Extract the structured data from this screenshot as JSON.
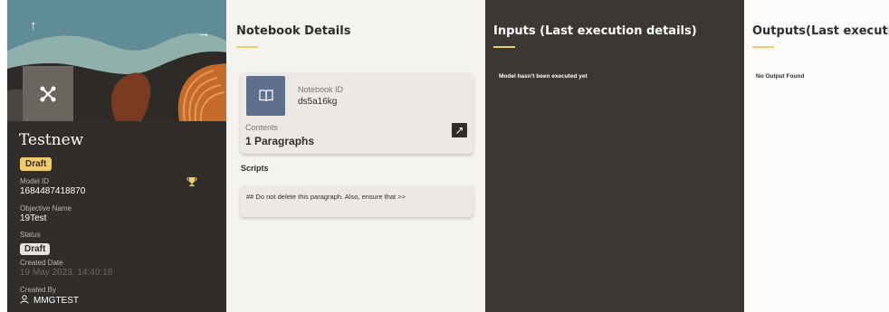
{
  "model": {
    "name": "Testnew",
    "draft_badge": "Draft",
    "model_id_label": "Model ID",
    "model_id": "1684487418870",
    "objective_label": "Objective Name",
    "objective": "19Test",
    "status_label": "Status",
    "status": "Draft",
    "created_date_label": "Created Date",
    "created_date": "19 May 2023, 14:40:18",
    "created_by_label": "Created By",
    "created_by": "MMGTEST"
  },
  "notebook": {
    "title": "Notebook Details",
    "id_label": "Notebook ID",
    "id": "ds5a16kg",
    "contents_label": "Contents",
    "contents_value": "1 Paragraphs",
    "scripts_label": "Scripts",
    "script_text": "## Do not delete this paragraph. Also, ensure that  >>"
  },
  "inputs": {
    "title": "Inputs (Last execution details)",
    "message": "Model hasn't been executed yet"
  },
  "outputs": {
    "title": "Outputs(Last execution",
    "message": "No Output Found"
  },
  "icons": {
    "up": "arrow-up-icon",
    "right": "arrow-right-icon",
    "model": "model-graph-icon",
    "trophy": "trophy-icon",
    "user": "user-icon",
    "notebook": "book-icon",
    "expand": "expand-icon"
  },
  "colors": {
    "dark_panel": "#312d2a",
    "accent": "#f0cc71",
    "notebook_icon_bg": "#5f6f8e"
  }
}
